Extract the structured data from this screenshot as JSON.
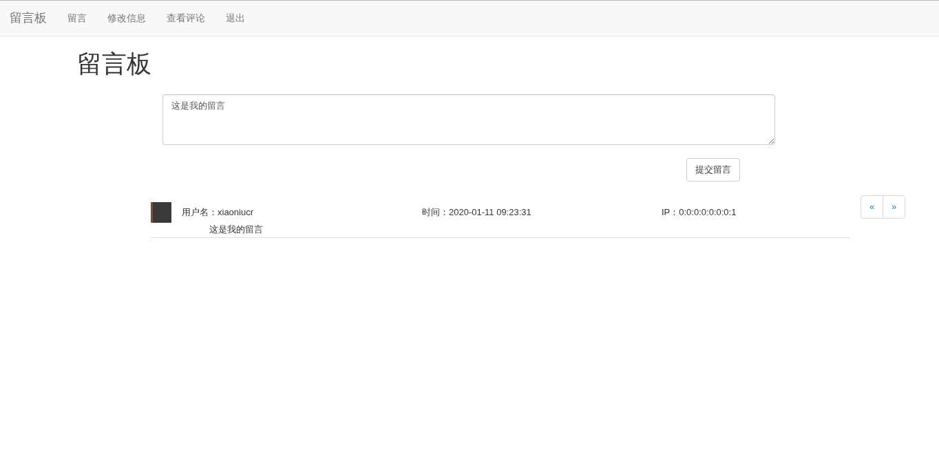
{
  "navbar": {
    "brand": "留言板",
    "items": [
      "留言",
      "修改信息",
      "查看评论",
      "退出"
    ]
  },
  "heading": "留言板",
  "message_input": {
    "value": "这是我的留言"
  },
  "submit_button": "提交留言",
  "comments": [
    {
      "username": "用户名：xiaoniucr",
      "time": "时间：2020-01-11 09:23:31",
      "ip": "IP：0:0:0:0:0:0:0:1",
      "message": "这是我的留言"
    }
  ],
  "pager": [
    "«",
    "»"
  ]
}
